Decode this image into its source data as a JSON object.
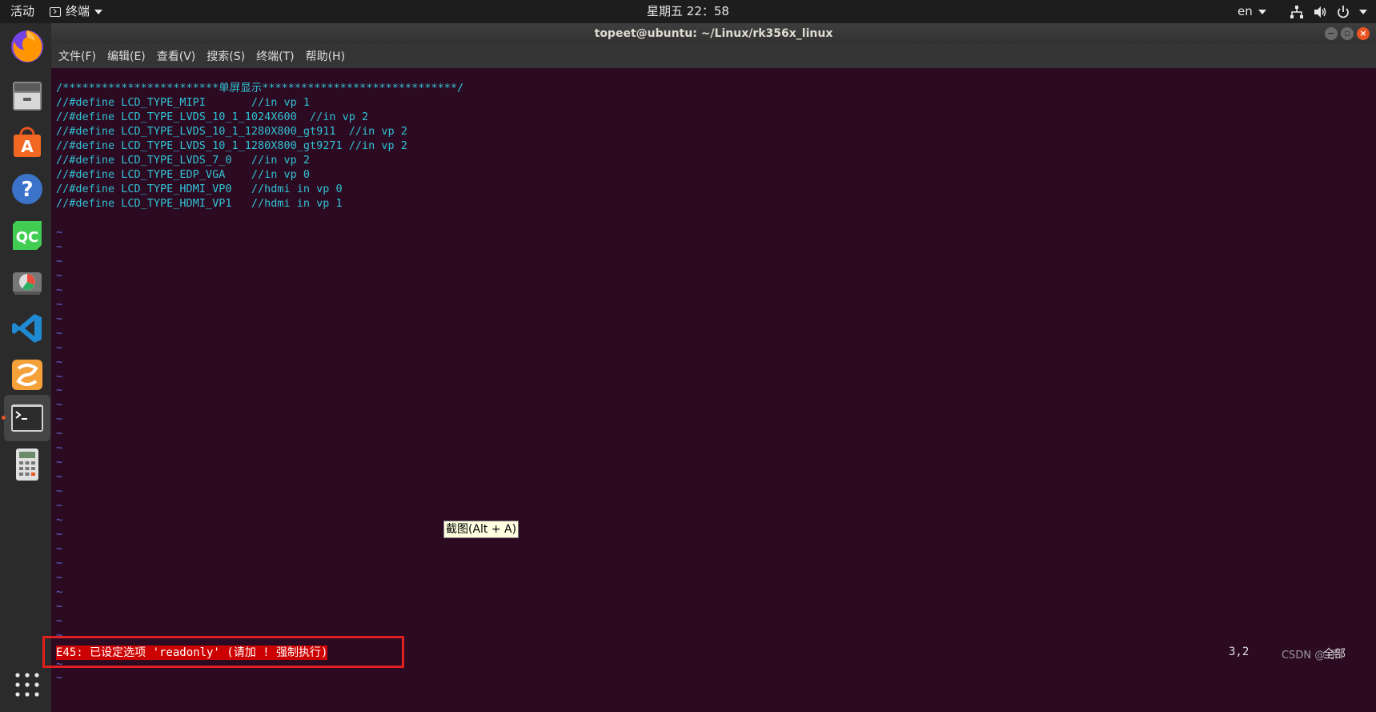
{
  "topbar": {
    "activities": "活动",
    "app_menu": "终端",
    "clock": "星期五 22：58",
    "lang": "en"
  },
  "dock": {
    "items": [
      {
        "name": "firefox-icon"
      },
      {
        "name": "files-icon"
      },
      {
        "name": "software-center-icon"
      },
      {
        "name": "help-icon"
      },
      {
        "name": "qt-creator-icon",
        "label": "QC"
      },
      {
        "name": "disk-usage-icon"
      },
      {
        "name": "vscode-icon"
      },
      {
        "name": "sublime-icon"
      },
      {
        "name": "terminal-icon"
      },
      {
        "name": "calculator-icon"
      },
      {
        "name": "show-apps-icon"
      }
    ]
  },
  "window": {
    "title": "topeet@ubuntu: ~/Linux/rk356x_linux",
    "menu": [
      "文件(F)",
      "编辑(E)",
      "查看(V)",
      "搜索(S)",
      "终端(T)",
      "帮助(H)"
    ]
  },
  "terminal": {
    "lines": [
      "",
      "/************************单屏显示******************************/",
      "//#define LCD_TYPE_MIPI       //in vp 1",
      "//#define LCD_TYPE_LVDS_10_1_1024X600  //in vp 2",
      "//#define LCD_TYPE_LVDS_10_1_1280X800_gt911  //in vp 2",
      "//#define LCD_TYPE_LVDS_10_1_1280X800_gt9271 //in vp 2",
      "//#define LCD_TYPE_LVDS_7_0   //in vp 2",
      "//#define LCD_TYPE_EDP_VGA    //in vp 0",
      "//#define LCD_TYPE_HDMI_VP0   //hdmi in vp 0",
      "//#define LCD_TYPE_HDMI_VP1   //hdmi in vp 1",
      ""
    ],
    "tilde": "~",
    "tilde_count": 32,
    "error": "E45: 已设定选项 'readonly' (请加 ! 强制执行)",
    "cursor_pos": "3,2",
    "percent": "全部",
    "watermark": "CSDN @     子",
    "tooltip": "截图(Alt + A)"
  },
  "colors": {
    "terminal_bg": "#2c0a22",
    "code": "#31c2d3",
    "tilde": "#5f6bd0",
    "error_bg": "#cc0000",
    "highlight_box": "#e02020"
  }
}
